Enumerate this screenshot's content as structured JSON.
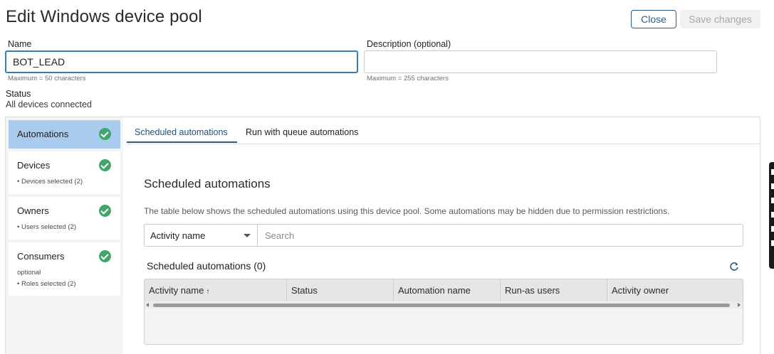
{
  "header": {
    "title": "Edit Windows device pool",
    "close_label": "Close",
    "save_label": "Save changes"
  },
  "form": {
    "name_label": "Name",
    "name_value": "BOT_LEAD",
    "name_hint": "Maximum = 50 characters",
    "description_label": "Description (optional)",
    "description_value": "",
    "description_hint": "Maximum = 255 characters",
    "status_label": "Status",
    "status_value": "All devices connected"
  },
  "sidebar": {
    "items": [
      {
        "title": "Automations",
        "sub": "",
        "sub2": "",
        "complete": true,
        "active": true
      },
      {
        "title": "Devices",
        "sub": "• Devices selected (2)",
        "sub2": "",
        "complete": true,
        "active": false
      },
      {
        "title": "Owners",
        "sub": "• Users selected (2)",
        "sub2": "",
        "complete": true,
        "active": false
      },
      {
        "title": "Consumers",
        "sub": "optional",
        "sub2": "• Roles selected (2)",
        "complete": true,
        "active": false
      }
    ]
  },
  "tabs": [
    {
      "label": "Scheduled automations",
      "active": true
    },
    {
      "label": "Run with queue automations",
      "active": false
    }
  ],
  "content": {
    "section_title": "Scheduled automations",
    "description": "The table below shows the scheduled automations using this device pool. Some automations may be hidden due to permission restrictions.",
    "filter_value": "Activity name",
    "search_placeholder": "Search",
    "table_title": "Scheduled automations (0)",
    "columns": [
      "Activity name",
      "Status",
      "Automation name",
      "Run-as users",
      "Activity owner"
    ],
    "sort_indicator": "↑"
  },
  "colors": {
    "accent": "#2c5d8a",
    "active_item": "#a9cbed",
    "check": "#3fa76a"
  },
  "icons": [
    "check-circle-icon",
    "chevron-down-icon",
    "refresh-icon",
    "sort-ascending-icon"
  ]
}
